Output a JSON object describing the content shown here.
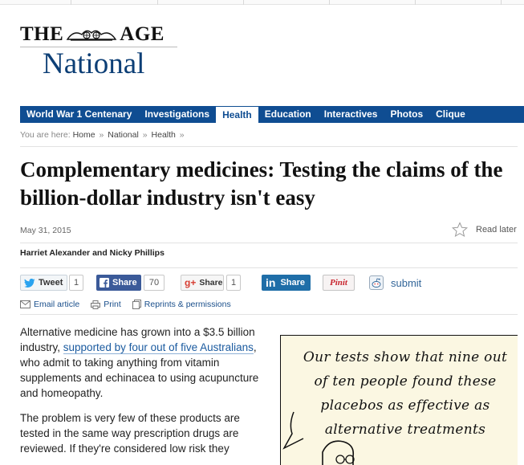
{
  "masthead": {
    "logo_left": "THE",
    "logo_right": "AGE",
    "section": "National"
  },
  "nav": {
    "items": [
      {
        "label": "World War 1 Centenary",
        "active": false
      },
      {
        "label": "Investigations",
        "active": false
      },
      {
        "label": "Health",
        "active": true
      },
      {
        "label": "Education",
        "active": false
      },
      {
        "label": "Interactives",
        "active": false
      },
      {
        "label": "Photos",
        "active": false
      },
      {
        "label": "Clique",
        "active": false
      }
    ]
  },
  "breadcrumb": {
    "prefix": "You are here:",
    "items": [
      "Home",
      "National",
      "Health"
    ],
    "separator": "»"
  },
  "article": {
    "headline": "Complementary medicines: Testing the claims of the billion-dollar industry isn't easy",
    "date": "May 31, 2015",
    "read_later": "Read later",
    "byline": "Harriet Alexander and Nicky Phillips",
    "para1_start": "Alternative medicine has grown into a $3.5 billion industry, ",
    "para1_link": "supported by four out of five Australians",
    "para1_end": ", who admit to taking anything from vitamin supplements and echinacea to using acupuncture and homeopathy.",
    "para2": "The problem is very few of these products are tested in the same way prescription drugs are reviewed. If they're considered low risk they"
  },
  "share": {
    "tweet_label": "Tweet",
    "tweet_count": "1",
    "facebook_label": "Share",
    "facebook_count": "70",
    "googleplus_label": "Share",
    "googleplus_count": "1",
    "linkedin_label": "Share",
    "pinterest_label": "Pinit",
    "reddit_label": "submit"
  },
  "tools": {
    "email": "Email article",
    "print": "Print",
    "reprints": "Reprints & permissions"
  },
  "cartoon": {
    "caption": "Our tests show that nine out of ten people found these placebos as effective as alternative treatments"
  },
  "colors": {
    "nav_bg": "#0f4d92",
    "section_blue": "#0d3f76",
    "link_blue": "#1a5a9f",
    "facebook": "#3b5a99",
    "linkedin": "#1f6ea8",
    "pinterest": "#c8232c",
    "cartoon_bg": "#fbf7e2"
  }
}
